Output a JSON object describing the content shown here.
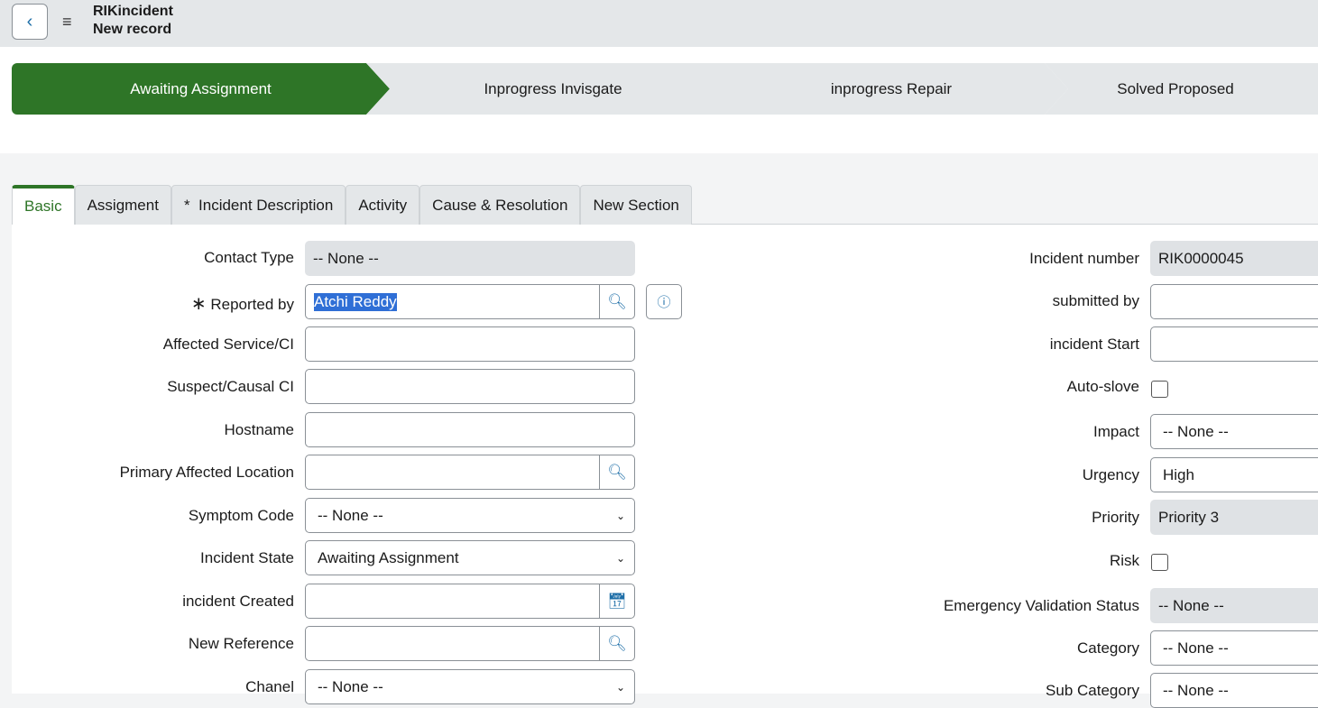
{
  "header": {
    "title": "RIKincident",
    "subtitle": "New record"
  },
  "stages": [
    "Awaiting Assignment",
    "Inprogress Invisgate",
    "inprogress Repair",
    "Solved Proposed"
  ],
  "tabs": [
    "Basic",
    "Assigment",
    "*  Incident Description",
    "Activity",
    "Cause & Resolution",
    "New Section"
  ],
  "left": {
    "contact_type": {
      "label": "Contact Type",
      "value": "-- None --"
    },
    "reported_by": {
      "label": "Reported by",
      "value": "Atchi Reddy"
    },
    "affected_service": {
      "label": "Affected Service/CI",
      "value": ""
    },
    "suspect": {
      "label": "Suspect/Causal CI",
      "value": ""
    },
    "hostname": {
      "label": "Hostname",
      "value": ""
    },
    "location": {
      "label": "Primary Affected Location",
      "value": ""
    },
    "symptom": {
      "label": "Symptom Code",
      "value": "-- None --"
    },
    "state": {
      "label": "Incident State",
      "value": "Awaiting Assignment"
    },
    "created": {
      "label": "incident Created",
      "value": ""
    },
    "reference": {
      "label": "New Reference",
      "value": ""
    },
    "chanel": {
      "label": "Chanel",
      "value": "-- None --"
    }
  },
  "right": {
    "number": {
      "label": "Incident number",
      "value": "RIK0000045"
    },
    "submitted": {
      "label": "submitted by",
      "value": ""
    },
    "start": {
      "label": "incident Start",
      "value": ""
    },
    "autoslove": {
      "label": "Auto-slove",
      "checked": false
    },
    "impact": {
      "label": "Impact",
      "value": "-- None --"
    },
    "urgency": {
      "label": "Urgency",
      "value": "High"
    },
    "priority": {
      "label": "Priority",
      "value": "Priority 3"
    },
    "risk": {
      "label": "Risk",
      "checked": false
    },
    "evs": {
      "label": "Emergency Validation Status",
      "value": "-- None --"
    },
    "category": {
      "label": "Category",
      "value": "-- None --"
    },
    "subcategory": {
      "label": "Sub Category",
      "value": "-- None --"
    }
  }
}
